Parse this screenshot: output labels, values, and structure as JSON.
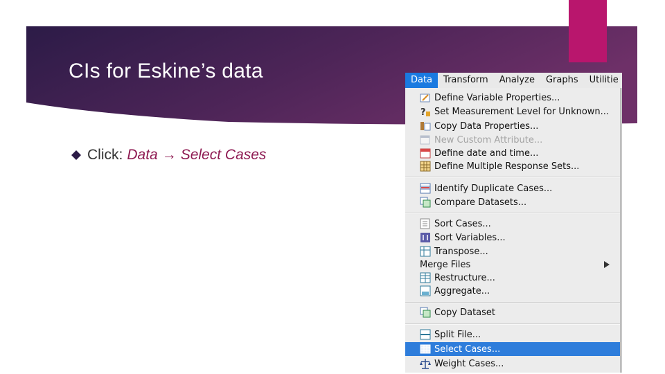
{
  "slide": {
    "title": "CIs for Eskine’s data",
    "bullet": {
      "prefix": "Click:",
      "path_start": "Data",
      "arrow": "→",
      "path_end": "Select Cases"
    },
    "colors": {
      "band_dark": "#2c1b47",
      "band_purple": "#632c62",
      "accent": "#b9166d",
      "path_text": "#8e1a52"
    }
  },
  "menubar": {
    "items": [
      "Data",
      "Transform",
      "Analyze",
      "Graphs",
      "Utilitie"
    ],
    "active": "Data",
    "active_color": "#1a7ae0"
  },
  "data_menu": {
    "items": [
      {
        "label": "Define Variable Properties...",
        "icon": "variable-properties-icon",
        "enabled": true
      },
      {
        "label": "Set Measurement Level for Unknown...",
        "icon": "measurement-level-icon",
        "enabled": true
      },
      {
        "label": "Copy Data Properties...",
        "icon": "copy-properties-icon",
        "enabled": true
      },
      {
        "label": "New Custom Attribute...",
        "icon": "custom-attribute-icon",
        "enabled": false
      },
      {
        "label": "Define date and time...",
        "icon": "calendar-icon",
        "enabled": true
      },
      {
        "label": "Define Multiple Response Sets...",
        "icon": "grid-icon",
        "enabled": true
      },
      {
        "label": "Identify Duplicate Cases...",
        "icon": "duplicate-cases-icon",
        "enabled": true
      },
      {
        "label": "Compare Datasets...",
        "icon": "compare-datasets-icon",
        "enabled": true
      },
      {
        "label": "Sort Cases...",
        "icon": "sort-cases-icon",
        "enabled": true
      },
      {
        "label": "Sort Variables...",
        "icon": "sort-variables-icon",
        "enabled": true
      },
      {
        "label": "Transpose...",
        "icon": "transpose-icon",
        "enabled": true
      },
      {
        "label": "Merge Files",
        "icon": "",
        "enabled": true,
        "submenu": true
      },
      {
        "label": "Restructure...",
        "icon": "restructure-icon",
        "enabled": true
      },
      {
        "label": "Aggregate...",
        "icon": "aggregate-icon",
        "enabled": true
      },
      {
        "label": "Copy Dataset",
        "icon": "copy-dataset-icon",
        "enabled": true
      },
      {
        "label": "Split File...",
        "icon": "split-file-icon",
        "enabled": true
      },
      {
        "label": "Select Cases...",
        "icon": "select-cases-icon",
        "enabled": true,
        "selected": true
      },
      {
        "label": "Weight Cases...",
        "icon": "weight-cases-icon",
        "enabled": true
      }
    ],
    "highlight_color": "#2e7ddb"
  }
}
